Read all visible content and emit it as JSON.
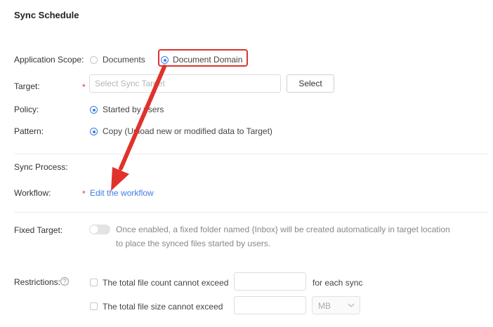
{
  "page": {
    "title": "Sync Schedule"
  },
  "scope": {
    "label": "Application Scope:",
    "options": [
      {
        "label": "Documents",
        "selected": false
      },
      {
        "label": "Document Domain",
        "selected": true
      }
    ]
  },
  "target": {
    "label": "Target:",
    "placeholder": "Select Sync Target",
    "button": "Select"
  },
  "policy": {
    "label": "Policy:",
    "option": "Started by users"
  },
  "pattern": {
    "label": "Pattern:",
    "option": "Copy (Upload new or modified data to Target)"
  },
  "sync_process": {
    "label": "Sync Process:"
  },
  "workflow": {
    "label": "Workflow:",
    "link": "Edit the workflow"
  },
  "fixed_target": {
    "label": "Fixed Target:",
    "enabled": false,
    "hint_line1": "Once enabled, a fixed folder named {Inbox} will be created automatically in target location",
    "hint_line2": "to place the synced files started by users."
  },
  "restrictions": {
    "label": "Restrictions:",
    "help_icon": "?",
    "file_count": {
      "label": "The total file count cannot exceed",
      "suffix": "for each sync",
      "checked": false
    },
    "file_size": {
      "label": "The total file size cannot exceed",
      "unit": "MB",
      "checked": false
    }
  },
  "colors": {
    "accent": "#3f7ce8",
    "required": "#e0322b",
    "annotation": "#e0322b"
  }
}
